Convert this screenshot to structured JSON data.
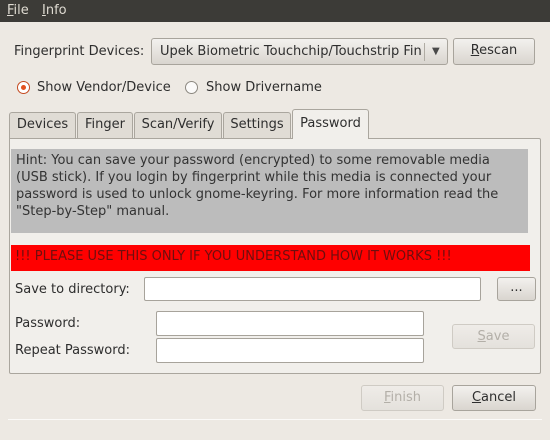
{
  "menubar": {
    "file": {
      "mnemonic": "F",
      "rest": "ile"
    },
    "info": {
      "mnemonic": "I",
      "rest": "nfo"
    }
  },
  "devices": {
    "label": "Fingerprint Devices:",
    "selected": "Upek Biometric Touchchip/Touchstrip Fingerprint Sensor",
    "rescan": {
      "mnemonic": "R",
      "rest": "escan"
    }
  },
  "display_mode": {
    "options": [
      {
        "label": "Show Vendor/Device",
        "checked": true
      },
      {
        "label": "Show Drivername",
        "checked": false
      }
    ]
  },
  "tabs": [
    {
      "label": "Devices",
      "active": false
    },
    {
      "label": "Finger",
      "active": false
    },
    {
      "label": "Scan/Verify",
      "active": false
    },
    {
      "label": "Settings",
      "active": false
    },
    {
      "label": "Password",
      "active": true
    }
  ],
  "password_tab": {
    "hint": "Hint: You can save your password (encrypted) to some removable media (USB stick). If you login by fingerprint while this media is connected your password is used to unlock gnome-keyring. For more information read the \"Step-by-Step\" manual.",
    "warning": "!!! PLEASE USE THIS ONLY IF YOU UNDERSTAND HOW IT WORKS !!!",
    "save_to_label": "Save to directory:",
    "save_to_value": "",
    "browse_label": "...",
    "password_label": "Password:",
    "password_value": "",
    "repeat_label": "Repeat Password:",
    "repeat_value": "",
    "save_button": {
      "mnemonic": "S",
      "rest": "ave"
    }
  },
  "footer": {
    "finish": {
      "mnemonic": "F",
      "rest": "inish"
    },
    "cancel": {
      "mnemonic": "C",
      "rest": "ancel"
    }
  },
  "colors": {
    "warning_bg": "#ff0000",
    "radio_accent": "#e2511e",
    "menubar_bg": "#3c3b37"
  }
}
